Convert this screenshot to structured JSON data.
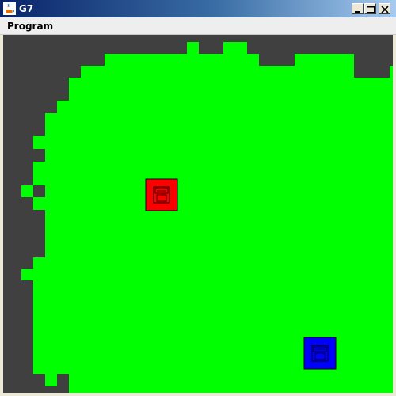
{
  "window": {
    "title": "G7",
    "icon": "java-cup-icon",
    "controls": [
      "minimize-icon",
      "maximize-icon",
      "close-icon"
    ]
  },
  "menu": {
    "items": [
      {
        "label": "Program"
      }
    ]
  },
  "game": {
    "colors": {
      "background": "#404040",
      "territory": "#00ff00",
      "player_red": "#ff0000",
      "player_blue": "#0000ff"
    },
    "players": [
      {
        "color": "red",
        "icon": "robot-icon"
      },
      {
        "color": "blue",
        "icon": "robot-icon"
      }
    ]
  }
}
